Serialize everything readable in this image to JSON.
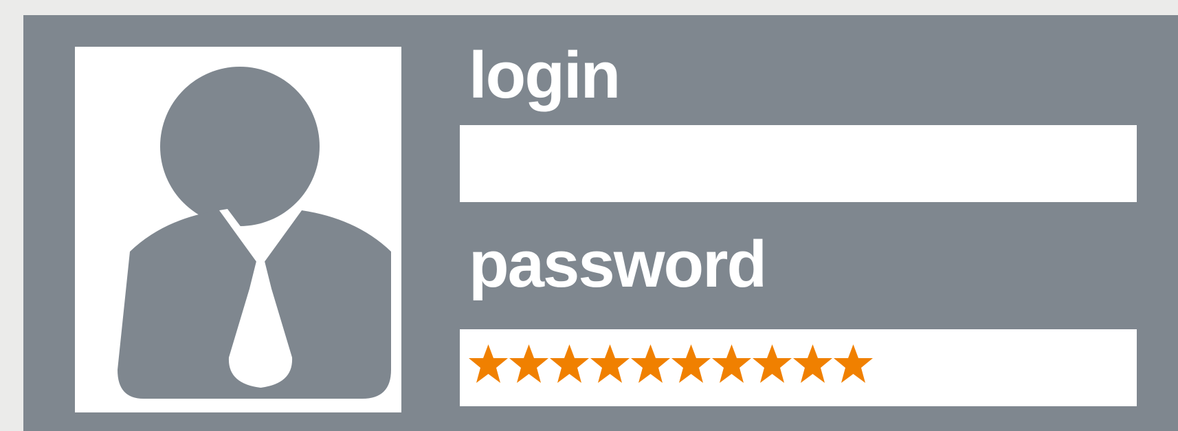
{
  "login_form": {
    "login_label": "login",
    "login_value": "",
    "password_label": "password",
    "password_value": "**********",
    "password_mask_color": "#f08000"
  },
  "avatar": {
    "icon": "user-businessman-icon"
  },
  "colors": {
    "panel": "#7f878f",
    "background": "#ebebea",
    "field": "#ffffff"
  }
}
